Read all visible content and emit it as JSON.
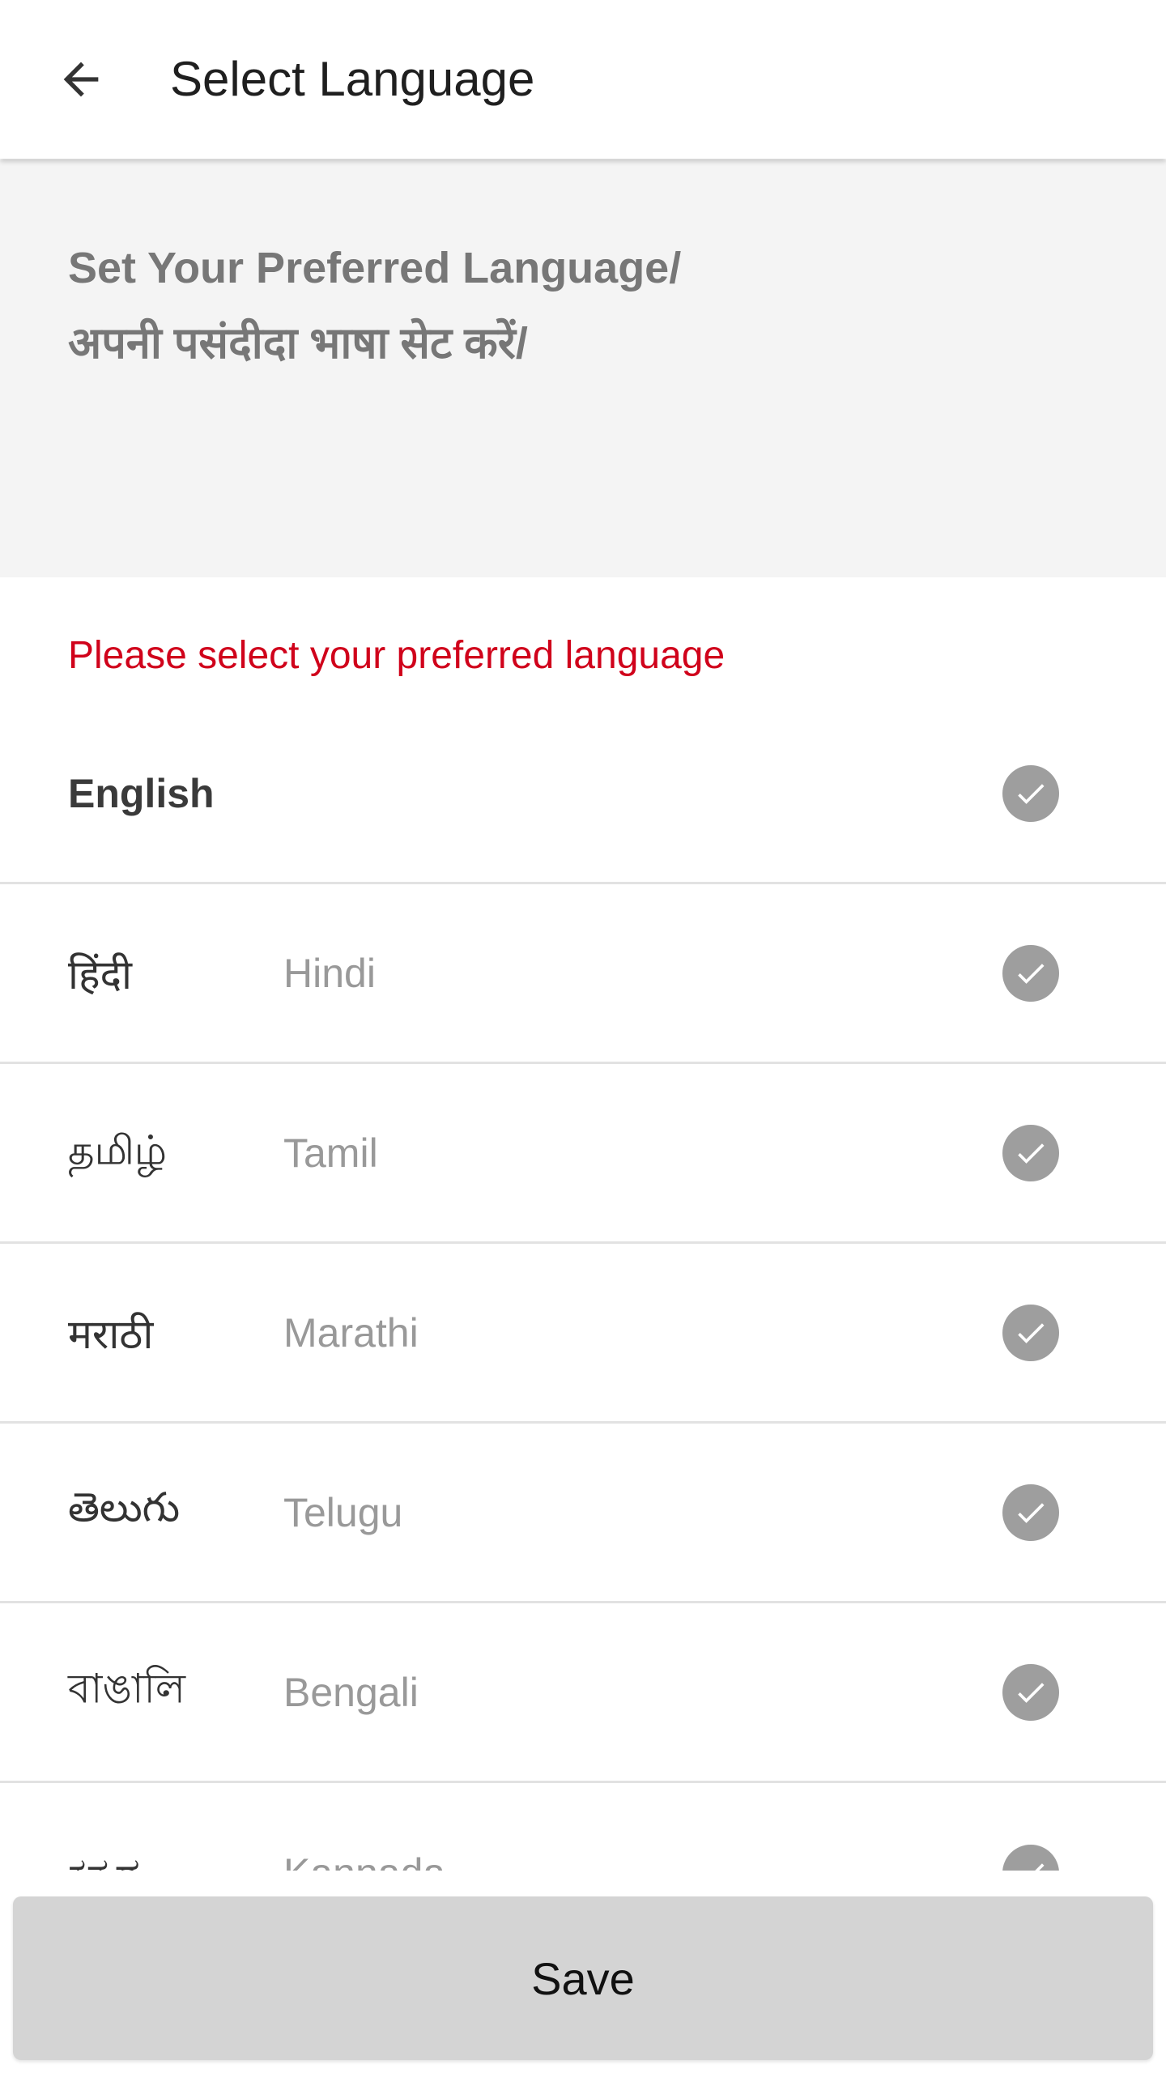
{
  "appbar": {
    "back_icon": "arrow-left-icon",
    "title": "Select Language"
  },
  "header": {
    "line1": "Set Your Preferred Language/",
    "line2": "अपनी पसंदीदा भाषा सेट करें/"
  },
  "instruction": "Please select your preferred language",
  "languages": [
    {
      "native": "English",
      "english": "",
      "selected": true
    },
    {
      "native": "हिंदी",
      "english": "Hindi",
      "selected": true
    },
    {
      "native": "தமிழ்",
      "english": "Tamil",
      "selected": true
    },
    {
      "native": "मराठी",
      "english": "Marathi",
      "selected": true
    },
    {
      "native": "తెలుగు",
      "english": "Telugu",
      "selected": true
    },
    {
      "native": "বাঙালি",
      "english": "Bengali",
      "selected": true
    },
    {
      "native": "ಕನ್ನಡ",
      "english": "Kannada",
      "selected": true
    }
  ],
  "save_label": "Save",
  "colors": {
    "instruction": "#d0021b",
    "check": "#9e9e9e",
    "header_bg": "#f4f4f4",
    "save_bg": "#d4d4d4"
  }
}
